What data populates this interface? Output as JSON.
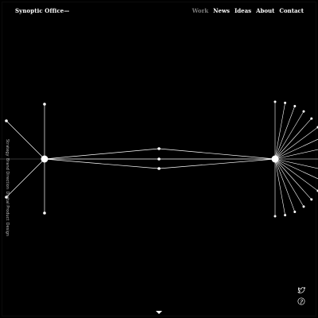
{
  "header": {
    "logo": "Synoptic Office—",
    "nav": [
      {
        "label": "Work",
        "active": true
      },
      {
        "label": "News",
        "active": false
      },
      {
        "label": "Ideas",
        "active": false
      },
      {
        "label": "About",
        "active": false
      },
      {
        "label": "Contact",
        "active": false
      }
    ]
  },
  "side_caption": "Strategy Brand Direction Digital Product Design",
  "social": {
    "icons": [
      "twitter-icon",
      "pinterest-icon"
    ]
  },
  "colors": {
    "background": "#000000",
    "foreground": "#ffffff",
    "muted": "#7a7a7a"
  }
}
